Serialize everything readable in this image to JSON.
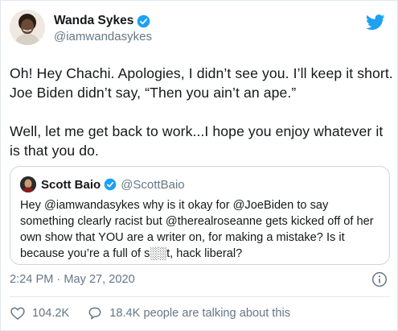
{
  "tweet": {
    "author_name": "Wanda Sykes",
    "author_handle": "@iamwandasykes",
    "text": "Oh! Hey Chachi.  Apologies, I didn’t see you.  I’ll keep it short.  Joe Biden didn’t say, “Then you ain’t an ape.”\n\nWell, let me get back to work...I hope you enjoy whatever it is that you do.",
    "timestamp": "2:24 PM · May 27, 2020",
    "likes": "104.2K",
    "replies_text": "18.4K people are talking about this"
  },
  "quoted_tweet": {
    "author_name": "Scott Baio",
    "author_handle": "@ScottBaio",
    "text": "Hey @iamwandasykes why is it okay for @JoeBiden to say something clearly racist but @therealroseanne gets kicked off of her own show that YOU are a writer on, for making a mistake? Is it because you’re a full of s░░t, hack liberal?"
  },
  "icons": {
    "brand": "twitter-bird-icon",
    "verified": "verified-badge-icon",
    "info": "info-icon",
    "like": "heart-icon",
    "reply": "speech-bubble-icon"
  },
  "colors": {
    "brand_blue": "#1da1f2",
    "text_primary": "#14171a",
    "text_secondary": "#657786",
    "border": "#ccd6dd"
  }
}
